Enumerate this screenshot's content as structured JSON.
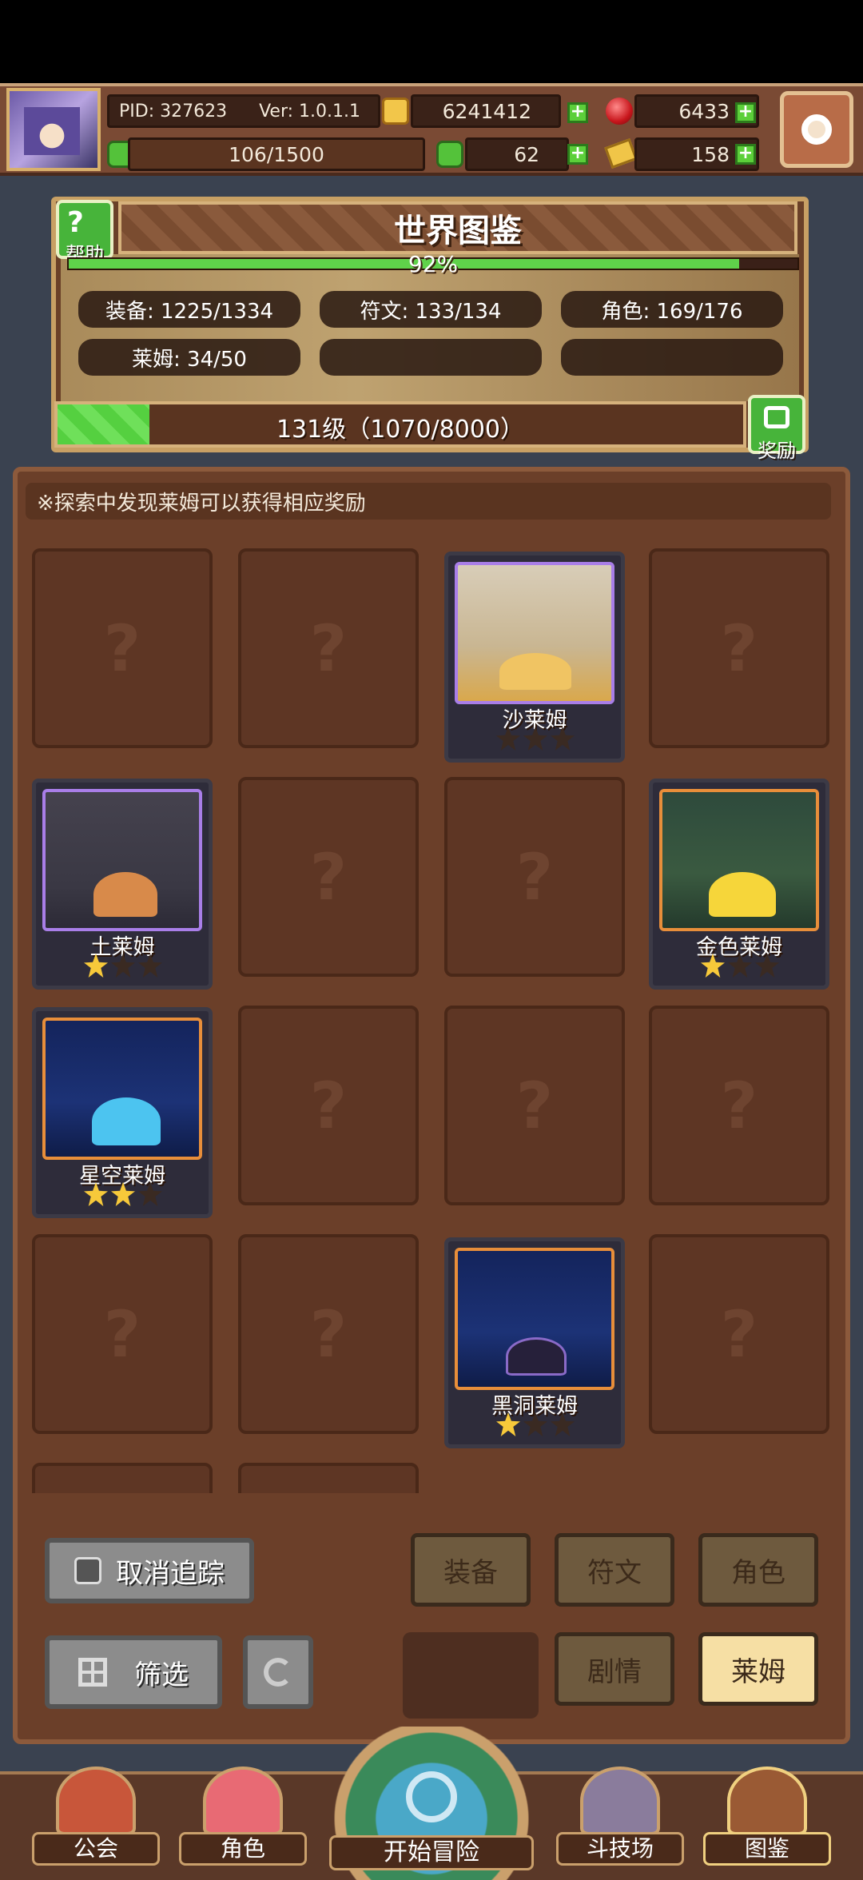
{
  "hud": {
    "pid": "PID: 327623",
    "version": "Ver: 1.0.1.1",
    "coins": "6241412",
    "gems": "6433",
    "stamina": "106/1500",
    "clover": "62",
    "tickets": "158"
  },
  "world_book": {
    "title": "世界图鉴",
    "help_label": "帮助",
    "completion_text": "92%",
    "completion": 0.92,
    "stats": {
      "equipment": "装备: 1225/1334",
      "runes": "符文: 133/134",
      "characters": "角色: 169/176",
      "slimes": "莱姆: 34/50"
    },
    "level_text": "131级（1070/8000）",
    "level_progress": 0.134,
    "reward_label": "奖励"
  },
  "hint": "※探索中发现莱姆可以获得相应奖励",
  "cards": {
    "sand": {
      "name": "沙莱姆",
      "stars": 0
    },
    "earth": {
      "name": "土莱姆",
      "stars": 1
    },
    "gold": {
      "name": "金色莱姆",
      "stars": 1
    },
    "star": {
      "name": "星空莱姆",
      "stars": 2
    },
    "blackhole": {
      "name": "黑洞莱姆",
      "stars": 1
    }
  },
  "buttons": {
    "untrack": "取消追踪",
    "filter": "筛选",
    "equipment": "装备",
    "runes": "符文",
    "characters": "角色",
    "story": "剧情",
    "slime": "莱姆"
  },
  "nav": {
    "guild": "公会",
    "character": "角色",
    "adventure": "开始冒险",
    "arena": "斗技场",
    "codex": "图鉴"
  }
}
